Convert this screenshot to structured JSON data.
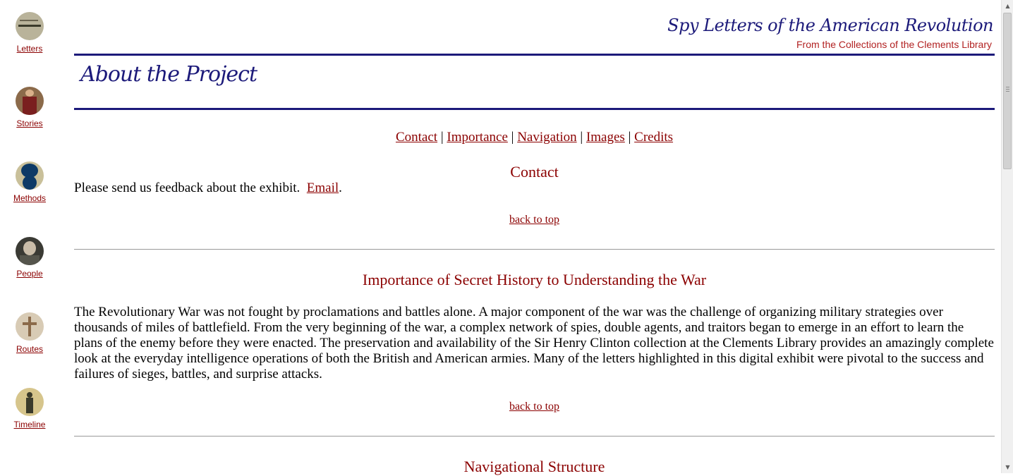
{
  "sidebar": {
    "items": [
      {
        "label": "Letters"
      },
      {
        "label": "Stories"
      },
      {
        "label": "Methods"
      },
      {
        "label": "People"
      },
      {
        "label": "Routes"
      },
      {
        "label": "Timeline"
      }
    ]
  },
  "header": {
    "banner_title": "Spy Letters of the American Revolution",
    "banner_subtitle": "From the Collections of the Clements Library",
    "page_title": "About the Project"
  },
  "nav": {
    "contact": "Contact",
    "importance": "Importance",
    "navigation": "Navigation",
    "images": "Images",
    "credits": "Credits",
    "separator": "|"
  },
  "sections": {
    "contact": {
      "title": "Contact",
      "text": "Please send us feedback about the exhibit.",
      "link": "Email",
      "link_suffix": "."
    },
    "importance": {
      "title": "Importance of Secret History to Understanding the War",
      "text": "The Revolutionary War was not fought by proclamations and battles alone.  A major component of the war was the challenge of organizing military strategies over thousands of miles of battlefield.  From the very beginning of the war, a complex network of spies, double agents, and traitors began to emerge in an effort to learn the plans of the enemy before they were enacted.  The preservation and availability of the Sir Henry Clinton collection at the Clements Library provides an amazingly complete look at the everyday intelligence operations of both the British and American armies.  Many of the letters highlighted in this digital exhibit were pivotal to the success and failures of sieges, battles, and surprise attacks."
    },
    "navigation": {
      "title": "Navigational Structure"
    }
  },
  "back_to_top": "back to top",
  "colors": {
    "accent_red": "#8b0000",
    "header_blue": "#1c1a7a",
    "banner_red": "#b22222"
  }
}
